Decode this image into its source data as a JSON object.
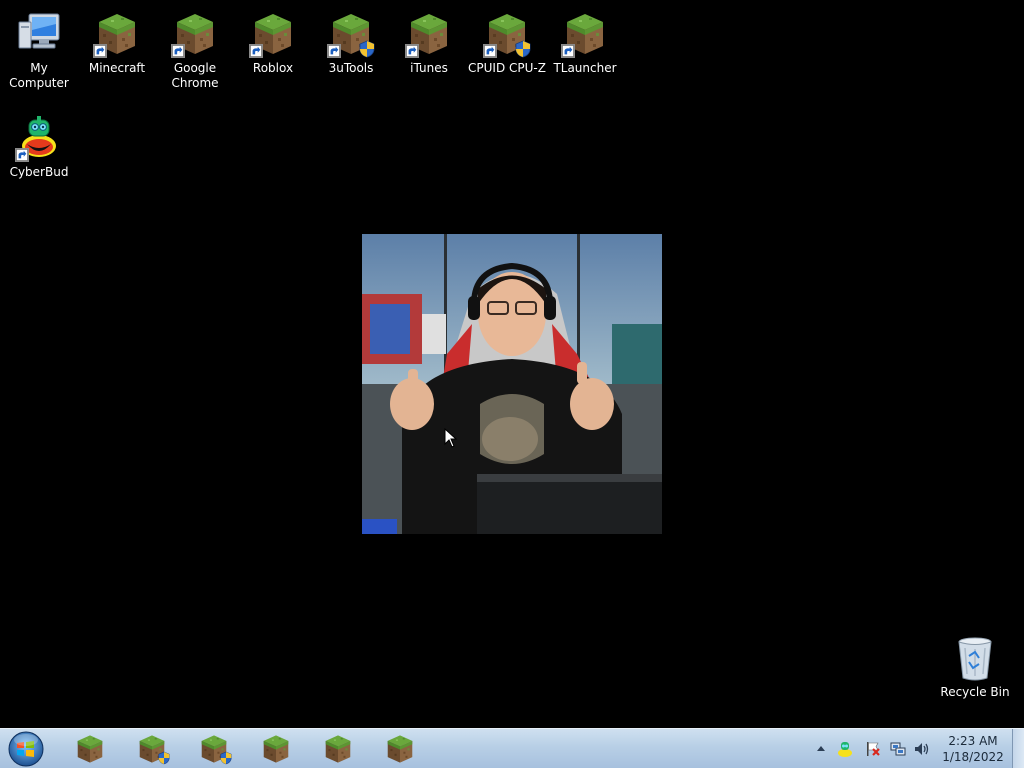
{
  "desktop": {
    "icons": [
      {
        "label": "My Computer",
        "icon": "computer-icon",
        "shortcut": false,
        "shield": false
      },
      {
        "label": "Minecraft",
        "icon": "minecraft-grass-block-icon",
        "shortcut": true,
        "shield": false
      },
      {
        "label": "Google Chrome",
        "icon": "minecraft-grass-block-icon",
        "shortcut": true,
        "shield": false
      },
      {
        "label": "Roblox",
        "icon": "minecraft-grass-block-icon",
        "shortcut": true,
        "shield": false
      },
      {
        "label": "3uTools",
        "icon": "minecraft-grass-block-icon",
        "shortcut": true,
        "shield": true
      },
      {
        "label": "iTunes",
        "icon": "minecraft-grass-block-icon",
        "shortcut": true,
        "shield": false
      },
      {
        "label": "CPUID CPU-Z",
        "icon": "minecraft-grass-block-icon",
        "shortcut": true,
        "shield": true
      },
      {
        "label": "TLauncher",
        "icon": "minecraft-grass-block-icon",
        "shortcut": true,
        "shield": false
      },
      {
        "label": "CyberBud",
        "icon": "cyberbud-icon",
        "shortcut": true,
        "shield": false
      },
      {
        "label": "Recycle Bin",
        "icon": "recycle-bin-icon",
        "shortcut": false,
        "shield": false
      }
    ]
  },
  "taskbar": {
    "pinned": [
      {
        "icon": "minecraft-grass-block-icon",
        "shield": false
      },
      {
        "icon": "minecraft-grass-block-icon",
        "shield": true
      },
      {
        "icon": "minecraft-grass-block-icon",
        "shield": true
      },
      {
        "icon": "minecraft-grass-block-icon",
        "shield": false
      },
      {
        "icon": "minecraft-grass-block-icon",
        "shield": false
      },
      {
        "icon": "minecraft-grass-block-icon",
        "shield": false
      }
    ],
    "tray": {
      "icons": [
        "show-hidden-icons-arrow-icon",
        "cyberbud-tray-icon",
        "action-center-flag-icon",
        "network-icon",
        "volume-icon"
      ]
    },
    "clock": {
      "time": "2:23 AM",
      "date": "1/18/2022"
    }
  },
  "colors": {
    "desktop_background": "#000000",
    "taskbar": "#b8cfe6",
    "grass_top": "#5f9e35",
    "dirt": "#7a5a3a"
  }
}
